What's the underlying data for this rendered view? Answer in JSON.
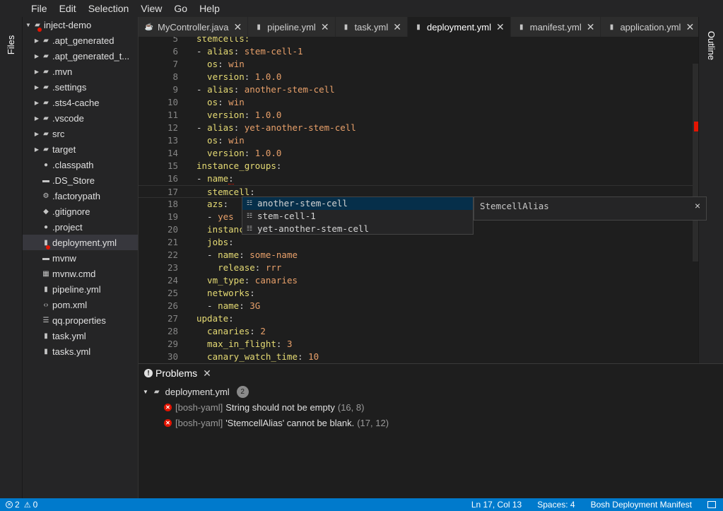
{
  "menu": [
    "File",
    "Edit",
    "Selection",
    "View",
    "Go",
    "Help"
  ],
  "left_rail": {
    "files_label": "Files"
  },
  "right_rail": {
    "outline_label": "Outline"
  },
  "explorer": {
    "root": "inject-demo",
    "items": [
      {
        "label": ".apt_generated",
        "kind": "folder"
      },
      {
        "label": ".apt_generated_t...",
        "kind": "folder"
      },
      {
        "label": ".mvn",
        "kind": "folder"
      },
      {
        "label": ".settings",
        "kind": "folder"
      },
      {
        "label": ".sts4-cache",
        "kind": "folder"
      },
      {
        "label": ".vscode",
        "kind": "folder"
      },
      {
        "label": "src",
        "kind": "folder"
      },
      {
        "label": "target",
        "kind": "folder"
      },
      {
        "label": ".classpath",
        "kind": "circle-icon"
      },
      {
        "label": ".DS_Store",
        "kind": "file-icon"
      },
      {
        "label": ".factorypath",
        "kind": "gear-icon"
      },
      {
        "label": ".gitignore",
        "kind": "diamond-icon"
      },
      {
        "label": ".project",
        "kind": "circle-icon"
      },
      {
        "label": "deployment.yml",
        "kind": "yaml-icon",
        "selected": true,
        "error": true
      },
      {
        "label": "mvnw",
        "kind": "file-icon"
      },
      {
        "label": "mvnw.cmd",
        "kind": "grid-icon"
      },
      {
        "label": "pipeline.yml",
        "kind": "yaml-icon"
      },
      {
        "label": "pom.xml",
        "kind": "code-icon"
      },
      {
        "label": "qq.properties",
        "kind": "list-icon"
      },
      {
        "label": "task.yml",
        "kind": "yaml-icon"
      },
      {
        "label": "tasks.yml",
        "kind": "yaml-icon"
      }
    ]
  },
  "tabs": [
    {
      "label": "MyController.java",
      "icon": "java-icon",
      "active": false
    },
    {
      "label": "pipeline.yml",
      "icon": "yaml-icon",
      "active": false
    },
    {
      "label": "task.yml",
      "icon": "yaml-icon",
      "active": false
    },
    {
      "label": "deployment.yml",
      "icon": "yaml-icon",
      "active": true
    },
    {
      "label": "manifest.yml",
      "icon": "yaml-icon",
      "active": false
    },
    {
      "label": "application.yml",
      "icon": "yaml-icon",
      "active": false
    }
  ],
  "editor": {
    "lines": [
      {
        "n": "5",
        "tokens": [
          {
            "t": "stemcells:",
            "c": "k"
          }
        ]
      },
      {
        "n": "6",
        "tokens": [
          {
            "t": "- ",
            "c": "p"
          },
          {
            "t": "alias",
            "c": "k"
          },
          {
            "t": ": ",
            "c": "p"
          },
          {
            "t": "stem-cell-1",
            "c": "v"
          }
        ]
      },
      {
        "n": "7",
        "tokens": [
          {
            "t": "  os",
            "c": "k"
          },
          {
            "t": ": ",
            "c": "p"
          },
          {
            "t": "win",
            "c": "v"
          }
        ]
      },
      {
        "n": "8",
        "tokens": [
          {
            "t": "  version",
            "c": "k"
          },
          {
            "t": ": ",
            "c": "p"
          },
          {
            "t": "1.0.0",
            "c": "v"
          }
        ]
      },
      {
        "n": "9",
        "tokens": [
          {
            "t": "- ",
            "c": "p"
          },
          {
            "t": "alias",
            "c": "k"
          },
          {
            "t": ": ",
            "c": "p"
          },
          {
            "t": "another-stem-cell",
            "c": "v"
          }
        ]
      },
      {
        "n": "10",
        "tokens": [
          {
            "t": "  os",
            "c": "k"
          },
          {
            "t": ": ",
            "c": "p"
          },
          {
            "t": "win",
            "c": "v"
          }
        ]
      },
      {
        "n": "11",
        "tokens": [
          {
            "t": "  version",
            "c": "k"
          },
          {
            "t": ": ",
            "c": "p"
          },
          {
            "t": "1.0.0",
            "c": "v"
          }
        ]
      },
      {
        "n": "12",
        "tokens": [
          {
            "t": "- ",
            "c": "p"
          },
          {
            "t": "alias",
            "c": "k"
          },
          {
            "t": ": ",
            "c": "p"
          },
          {
            "t": "yet-another-stem-cell",
            "c": "v"
          }
        ]
      },
      {
        "n": "13",
        "tokens": [
          {
            "t": "  os",
            "c": "k"
          },
          {
            "t": ": ",
            "c": "p"
          },
          {
            "t": "win",
            "c": "v"
          }
        ]
      },
      {
        "n": "14",
        "tokens": [
          {
            "t": "  version",
            "c": "k"
          },
          {
            "t": ": ",
            "c": "p"
          },
          {
            "t": "1.0.0",
            "c": "v"
          }
        ]
      },
      {
        "n": "15",
        "tokens": [
          {
            "t": "instance_groups",
            "c": "k"
          },
          {
            "t": ":",
            "c": "p"
          }
        ]
      },
      {
        "n": "16",
        "tokens": [
          {
            "t": "- ",
            "c": "p"
          },
          {
            "t": "name",
            "c": "k"
          },
          {
            "t": ":",
            "c": "p squig"
          }
        ]
      },
      {
        "n": "17",
        "tokens": [
          {
            "t": "  stemcell",
            "c": "k"
          },
          {
            "t": ":",
            "c": "p squig"
          }
        ],
        "current": true
      },
      {
        "n": "18",
        "tokens": [
          {
            "t": "  azs",
            "c": "k"
          },
          {
            "t": ":",
            "c": "p"
          }
        ]
      },
      {
        "n": "19",
        "tokens": [
          {
            "t": "  - ",
            "c": "p"
          },
          {
            "t": "yes",
            "c": "v"
          }
        ]
      },
      {
        "n": "20",
        "tokens": [
          {
            "t": "  instanc",
            "c": "k"
          }
        ]
      },
      {
        "n": "21",
        "tokens": [
          {
            "t": "  jobs",
            "c": "k"
          },
          {
            "t": ":",
            "c": "p"
          }
        ]
      },
      {
        "n": "22",
        "tokens": [
          {
            "t": "  - ",
            "c": "p"
          },
          {
            "t": "name",
            "c": "k"
          },
          {
            "t": ": ",
            "c": "p"
          },
          {
            "t": "some-name",
            "c": "v"
          }
        ]
      },
      {
        "n": "23",
        "tokens": [
          {
            "t": "    release",
            "c": "k"
          },
          {
            "t": ": ",
            "c": "p"
          },
          {
            "t": "rrr",
            "c": "v"
          }
        ]
      },
      {
        "n": "24",
        "tokens": [
          {
            "t": "  vm_type",
            "c": "k"
          },
          {
            "t": ": ",
            "c": "p"
          },
          {
            "t": "canaries",
            "c": "v"
          }
        ]
      },
      {
        "n": "25",
        "tokens": [
          {
            "t": "  networks",
            "c": "k"
          },
          {
            "t": ":",
            "c": "p"
          }
        ]
      },
      {
        "n": "26",
        "tokens": [
          {
            "t": "  - ",
            "c": "p"
          },
          {
            "t": "name",
            "c": "k"
          },
          {
            "t": ": ",
            "c": "p"
          },
          {
            "t": "3G",
            "c": "v"
          }
        ]
      },
      {
        "n": "27",
        "tokens": [
          {
            "t": "update",
            "c": "k"
          },
          {
            "t": ":",
            "c": "p"
          }
        ]
      },
      {
        "n": "28",
        "tokens": [
          {
            "t": "  canaries",
            "c": "k"
          },
          {
            "t": ": ",
            "c": "p"
          },
          {
            "t": "2",
            "c": "v"
          }
        ]
      },
      {
        "n": "29",
        "tokens": [
          {
            "t": "  max_in_flight",
            "c": "k"
          },
          {
            "t": ": ",
            "c": "p"
          },
          {
            "t": "3",
            "c": "v"
          }
        ]
      },
      {
        "n": "30",
        "tokens": [
          {
            "t": "  canary_watch_time",
            "c": "k"
          },
          {
            "t": ": ",
            "c": "p"
          },
          {
            "t": "10",
            "c": "v"
          }
        ]
      }
    ]
  },
  "suggest": {
    "items": [
      "another-stem-cell",
      "stem-cell-1",
      "yet-another-stem-cell"
    ],
    "focused_index": 0,
    "detail": "StemcellAlias",
    "close_glyph": "×"
  },
  "problems": {
    "title": "Problems",
    "file": "deployment.yml",
    "count": "2",
    "rows": [
      {
        "source": "[bosh-yaml]",
        "message": "String should not be empty",
        "location": "(16, 8)"
      },
      {
        "source": "[bosh-yaml]",
        "message": "'StemcellAlias' cannot be blank.",
        "location": "(17, 12)"
      }
    ]
  },
  "status": {
    "errors": "2",
    "warnings": "0",
    "position": "Ln 17, Col 13",
    "spaces": "Spaces: 4",
    "language": "Bosh Deployment Manifest"
  },
  "colors": {
    "status_bar": "#007acc",
    "error": "#e51400",
    "key": "#e6db74",
    "value": "#e8a06a",
    "selection": "#062f4a"
  }
}
